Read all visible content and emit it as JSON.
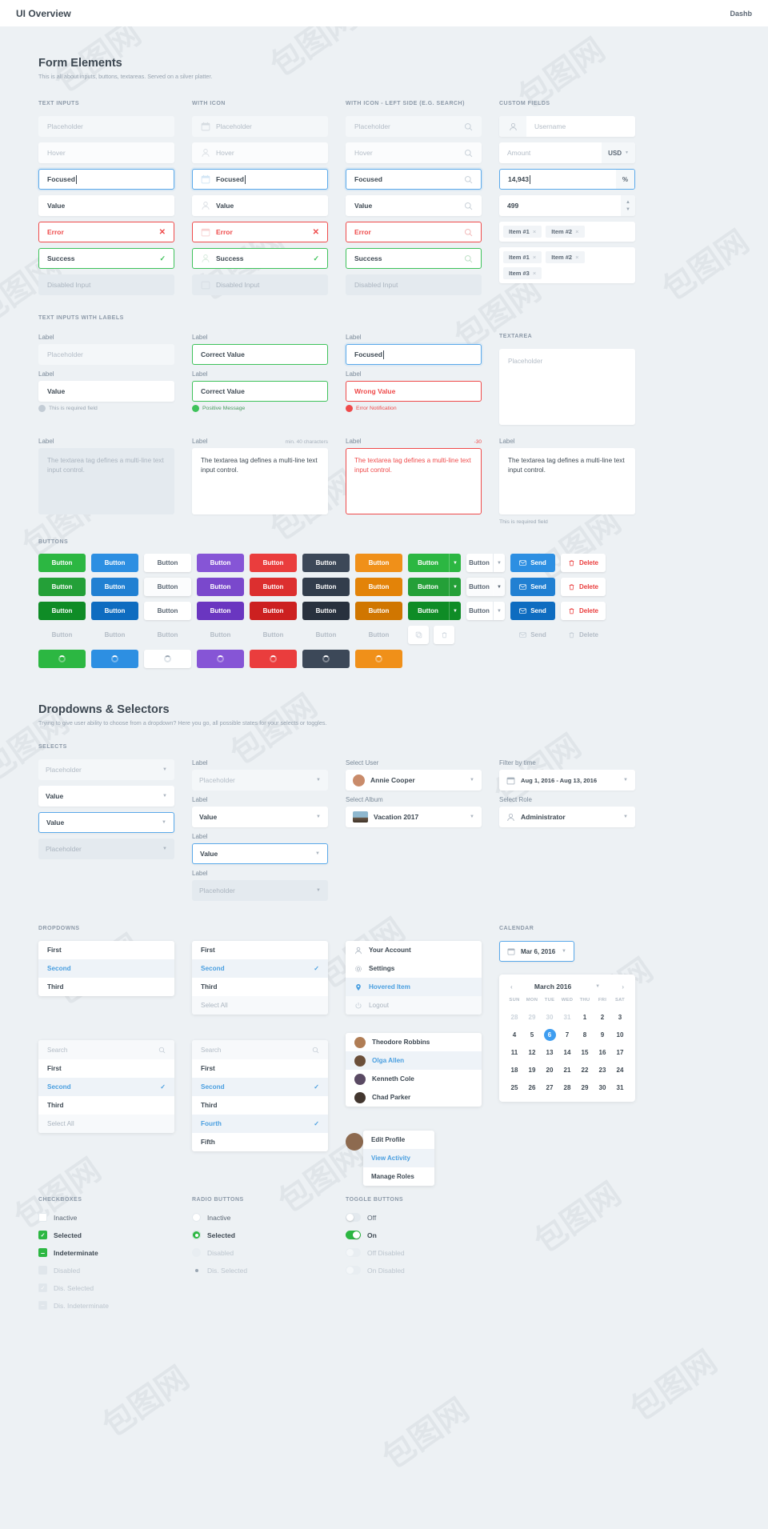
{
  "topbar": {
    "title": "UI Overview",
    "right": "Dashb"
  },
  "sections": {
    "form": {
      "title": "Form Elements",
      "subtitle": "This is all about inputs, buttons, textareas. Served on a silver platter."
    },
    "dropdowns": {
      "title": "Dropdowns & Selectors",
      "subtitle": "Trying to give user ability to choose from a dropdown? Here you go, all possible states for your selects or toggles."
    }
  },
  "group_labels": {
    "text_inputs": "TEXT INPUTS",
    "with_icon": "WITH ICON",
    "with_icon_left": "WITH ICON - LEFT SIDE (E.G. SEARCH)",
    "custom_fields": "CUSTOM FIELDS",
    "inputs_with_labels": "TEXT INPUTS WITH LABELS",
    "textarea": "TEXTAREA",
    "buttons": "BUTTONS",
    "selects": "SELECTS",
    "dropdowns": "DROPDOWNS",
    "calendar": "CALENDAR",
    "checkboxes": "CHECKBOXES",
    "radio_buttons": "RADIO BUTTONS",
    "toggle_buttons": "TOGGLE BUTTONS"
  },
  "input_states": [
    "Placeholder",
    "Hover",
    "Focused",
    "Value",
    "Error",
    "Success",
    "Disabled Input"
  ],
  "labels": {
    "label": "Label"
  },
  "labeled_inputs": {
    "col1": [
      {
        "label": "Label",
        "value": "Placeholder",
        "state": "ph"
      },
      {
        "label": "Label",
        "value": "Value",
        "state": "val",
        "msg": "This is required field",
        "msg_type": "info"
      }
    ],
    "col2": [
      {
        "label": "Label",
        "value": "Correct Value",
        "state": "ok"
      },
      {
        "label": "Label",
        "value": "Correct Value",
        "state": "ok",
        "msg": "Positive Message",
        "msg_type": "good"
      }
    ],
    "col3": [
      {
        "label": "Label",
        "value": "Focused",
        "state": "focus"
      },
      {
        "label": "Label",
        "value": "Wrong Value",
        "state": "err",
        "msg": "Error Notification",
        "msg_type": "bad"
      }
    ]
  },
  "textareas": {
    "body": "The textarea tag defines a multi-line text input control.",
    "hint_min": "min. 40 characters",
    "hint_neg": "-30",
    "placeholder": "Placeholder",
    "required_note": "This is required field"
  },
  "custom_fields": {
    "username_placeholder": "Username",
    "amount_placeholder": "Amount",
    "currency": "USD",
    "focused_value": "14,943",
    "percent": "%",
    "stepper_value": "499",
    "tags_row1": [
      "Item #1",
      "Item #2"
    ],
    "tags_row2": [
      "Item #1",
      "Item #2",
      "Item #3"
    ]
  },
  "buttons": {
    "label": "Button",
    "send": "Send",
    "delete": "Delete",
    "colors": [
      "green",
      "blue",
      "white",
      "purple",
      "red",
      "dark",
      "orange"
    ]
  },
  "selects": {
    "placeholder": "Placeholder",
    "value": "Value",
    "select_user": {
      "label": "Select User",
      "value": "Annie Cooper"
    },
    "select_album": {
      "label": "Select Album",
      "value": "Vacation 2017"
    },
    "filter_by_time": {
      "label": "Filter by time",
      "value": "Aug 1, 2016 - Aug 13, 2016"
    },
    "select_role": {
      "label": "Select Role",
      "value": "Administrator"
    }
  },
  "dropdowns": {
    "simple": [
      "First",
      "Second",
      "Third"
    ],
    "with_select_all": [
      "First",
      "Second",
      "Third",
      "Select All"
    ],
    "account_menu": [
      "Your Account",
      "Settings",
      "Hovered Item",
      "Logout"
    ],
    "search_placeholder": "Search",
    "searchable": [
      "First",
      "Second",
      "Third",
      "Select All"
    ],
    "searchable2": [
      "First",
      "Second",
      "Third",
      "Fourth",
      "Fifth"
    ],
    "people": [
      "Theodore Robbins",
      "Olga Allen",
      "Kenneth Cole",
      "Chad Parker"
    ],
    "profile_menu": [
      "Edit Profile",
      "View Activity",
      "Manage Roles"
    ]
  },
  "calendar": {
    "trigger": "Mar 6, 2016",
    "title": "March 2016",
    "dow": [
      "SUN",
      "MON",
      "TUE",
      "WED",
      "THU",
      "FRI",
      "SAT"
    ],
    "weeks": [
      [
        {
          "d": "28",
          "out": true
        },
        {
          "d": "29",
          "out": true
        },
        {
          "d": "30",
          "out": true
        },
        {
          "d": "31",
          "out": true
        },
        {
          "d": "1"
        },
        {
          "d": "2"
        },
        {
          "d": "3"
        }
      ],
      [
        {
          "d": "4"
        },
        {
          "d": "5"
        },
        {
          "d": "6",
          "on": true
        },
        {
          "d": "7"
        },
        {
          "d": "8"
        },
        {
          "d": "9"
        },
        {
          "d": "10"
        }
      ],
      [
        {
          "d": "11"
        },
        {
          "d": "12"
        },
        {
          "d": "13"
        },
        {
          "d": "14"
        },
        {
          "d": "15"
        },
        {
          "d": "16"
        },
        {
          "d": "17"
        }
      ],
      [
        {
          "d": "18"
        },
        {
          "d": "19"
        },
        {
          "d": "20"
        },
        {
          "d": "21"
        },
        {
          "d": "22"
        },
        {
          "d": "23"
        },
        {
          "d": "24"
        }
      ],
      [
        {
          "d": "25"
        },
        {
          "d": "26"
        },
        {
          "d": "27"
        },
        {
          "d": "28"
        },
        {
          "d": "29"
        },
        {
          "d": "30"
        },
        {
          "d": "31"
        }
      ]
    ]
  },
  "checkboxes": [
    "Inactive",
    "Selected",
    "Indeterminate",
    "Disabled",
    "Dis. Selected",
    "Dis. Indeterminate"
  ],
  "radios": [
    "Inactive",
    "Selected",
    "Disabled",
    "Dis. Selected"
  ],
  "toggles": [
    "Off",
    "On",
    "Off Disabled",
    "On Disabled"
  ],
  "colors": {
    "green": "#2cb742",
    "blue": "#2d8fe2",
    "purple": "#8655d6",
    "red": "#ea3d3d",
    "dark": "#3c4858",
    "orange": "#f09019",
    "accent": "#4a9fe0",
    "bg": "#edf1f4"
  },
  "watermark": "包图网"
}
